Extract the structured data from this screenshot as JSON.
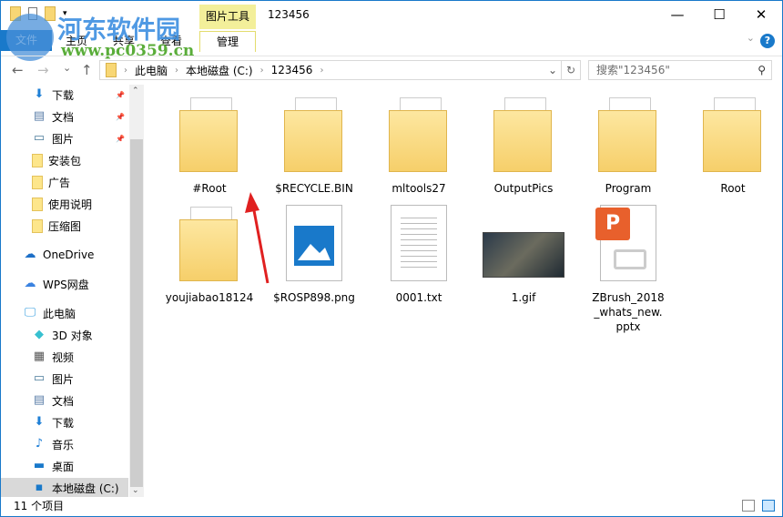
{
  "window": {
    "title": "123456",
    "context_tab": "图片工具",
    "minimize": "—",
    "maximize": "☐",
    "close": "✕"
  },
  "ribbon": {
    "tabs": [
      "文件",
      "主页",
      "共享",
      "查看",
      "管理"
    ],
    "help": "?",
    "expand": "⌄"
  },
  "address": {
    "back": "←",
    "forward": "→",
    "recent": "⌄",
    "up": "↑",
    "crumbs": [
      "此电脑",
      "本地磁盘 (C:)",
      "123456"
    ],
    "separator": "›",
    "refresh": "↻",
    "dropdown": "⌄"
  },
  "search": {
    "placeholder": "搜索\"123456\"",
    "icon": "⚲"
  },
  "sidebar": {
    "items": [
      {
        "label": "下载",
        "icon": "download-icon",
        "glyph": "⬇",
        "pinned": true
      },
      {
        "label": "文档",
        "icon": "document-icon",
        "glyph": "▤",
        "pinned": true
      },
      {
        "label": "图片",
        "icon": "picture-icon",
        "glyph": "▭",
        "pinned": true
      },
      {
        "label": "安装包",
        "icon": "folder-icon",
        "glyph": ""
      },
      {
        "label": "广告",
        "icon": "folder-icon",
        "glyph": ""
      },
      {
        "label": "使用说明",
        "icon": "folder-icon",
        "glyph": ""
      },
      {
        "label": "压缩图",
        "icon": "folder-icon",
        "glyph": ""
      },
      {
        "label": "OneDrive",
        "icon": "onedrive-icon",
        "glyph": "☁"
      },
      {
        "label": "WPS网盘",
        "icon": "cloud-icon",
        "glyph": "☁"
      },
      {
        "label": "此电脑",
        "icon": "computer-icon",
        "glyph": "🖵"
      },
      {
        "label": "3D 对象",
        "icon": "3d-objects-icon",
        "glyph": "◆"
      },
      {
        "label": "视频",
        "icon": "video-icon",
        "glyph": "▦"
      },
      {
        "label": "图片",
        "icon": "picture-icon",
        "glyph": "▭"
      },
      {
        "label": "文档",
        "icon": "document-icon",
        "glyph": "▤"
      },
      {
        "label": "下载",
        "icon": "download-icon",
        "glyph": "⬇"
      },
      {
        "label": "音乐",
        "icon": "music-icon",
        "glyph": "♪"
      },
      {
        "label": "桌面",
        "icon": "desktop-icon",
        "glyph": "▬"
      },
      {
        "label": "本地磁盘 (C:)",
        "icon": "drive-icon",
        "glyph": "▪"
      }
    ],
    "pin": "📌",
    "scroll_up": "⌃",
    "scroll_down": "⌄"
  },
  "files": [
    {
      "name": "#Root",
      "type": "folder"
    },
    {
      "name": "$RECYCLE.BIN",
      "type": "folder"
    },
    {
      "name": "mltools27",
      "type": "folder"
    },
    {
      "name": "OutputPics",
      "type": "folder"
    },
    {
      "name": "Program",
      "type": "folder"
    },
    {
      "name": "Root",
      "type": "folder"
    },
    {
      "name": "youjiabao18124",
      "type": "folder"
    },
    {
      "name": "$ROSP898.png",
      "type": "png"
    },
    {
      "name": "0001.txt",
      "type": "txt"
    },
    {
      "name": "1.gif",
      "type": "gif"
    },
    {
      "name": "ZBrush_2018_whats_new.pptx",
      "type": "pptx"
    }
  ],
  "status": {
    "count": "11 个项目"
  },
  "watermark": {
    "title": "河东软件园",
    "url": "www.pc0359.cn"
  },
  "colors": {
    "accent": "#1979ca",
    "context": "#f3ef9a",
    "arrow": "#e02020"
  }
}
